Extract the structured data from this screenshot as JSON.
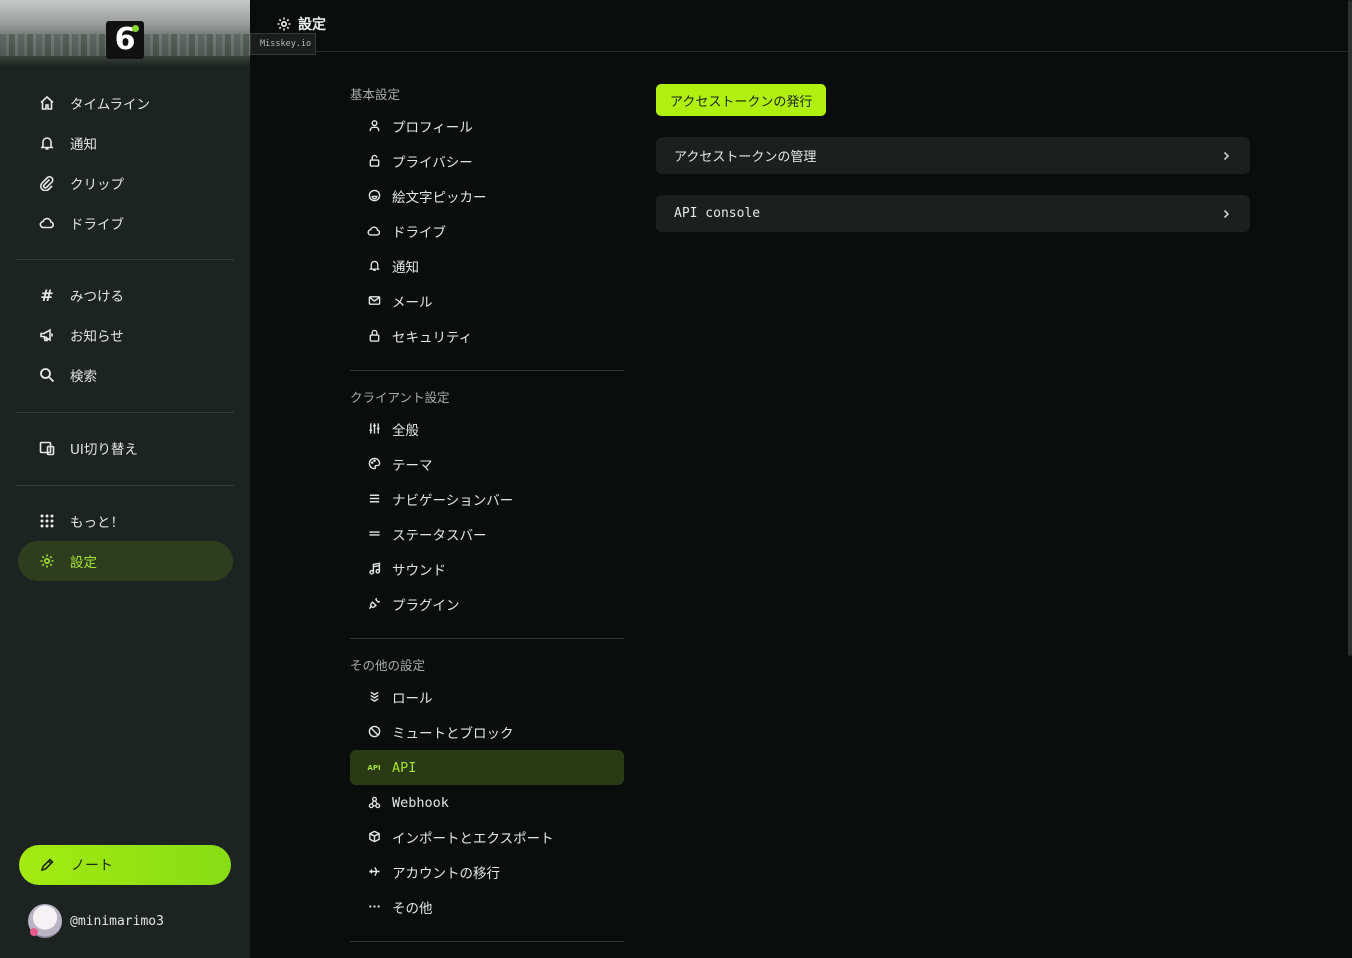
{
  "sidebar": {
    "instance_tooltip": "Misskey.io",
    "nav_main": [
      {
        "label": "タイムライン",
        "icon": "home-icon"
      },
      {
        "label": "通知",
        "icon": "bell-icon"
      },
      {
        "label": "クリップ",
        "icon": "paperclip-icon"
      },
      {
        "label": "ドライブ",
        "icon": "cloud-icon"
      }
    ],
    "nav_explore": [
      {
        "label": "みつける",
        "icon": "hash-icon"
      },
      {
        "label": "お知らせ",
        "icon": "speakerphone-icon"
      },
      {
        "label": "検索",
        "icon": "search-icon"
      }
    ],
    "nav_ui": [
      {
        "label": "UI切り替え",
        "icon": "devices-icon"
      }
    ],
    "nav_more": [
      {
        "label": "もっと！",
        "icon": "grid-dots-icon"
      },
      {
        "label": "設定",
        "icon": "settings-icon",
        "active": true
      }
    ],
    "note_button": "ノート",
    "account": "@minimarimo3"
  },
  "header": {
    "title": "設定"
  },
  "settings_menu": {
    "sections": [
      {
        "label": "基本設定",
        "items": [
          "プロフィール",
          "プライバシー",
          "絵文字ピッカー",
          "ドライブ",
          "通知",
          "メール",
          "セキュリティ"
        ]
      },
      {
        "label": "クライアント設定",
        "items": [
          "全般",
          "テーマ",
          "ナビゲーションバー",
          "ステータスバー",
          "サウンド",
          "プラグイン"
        ]
      },
      {
        "label": "その他の設定",
        "items": [
          "ロール",
          "ミュートとブロック",
          "API",
          "Webhook",
          "インポートとエクスポート",
          "アカウントの移行",
          "その他"
        ]
      }
    ],
    "active_item": "API"
  },
  "main": {
    "issue_token_button": "アクセストークンの発行",
    "links": [
      {
        "label": "アクセストークンの管理"
      },
      {
        "label": "API console"
      }
    ]
  },
  "colors": {
    "accent": "#a6e22e",
    "sidebar_bg": "#1d2320",
    "page_bg": "#0b0d0c"
  }
}
